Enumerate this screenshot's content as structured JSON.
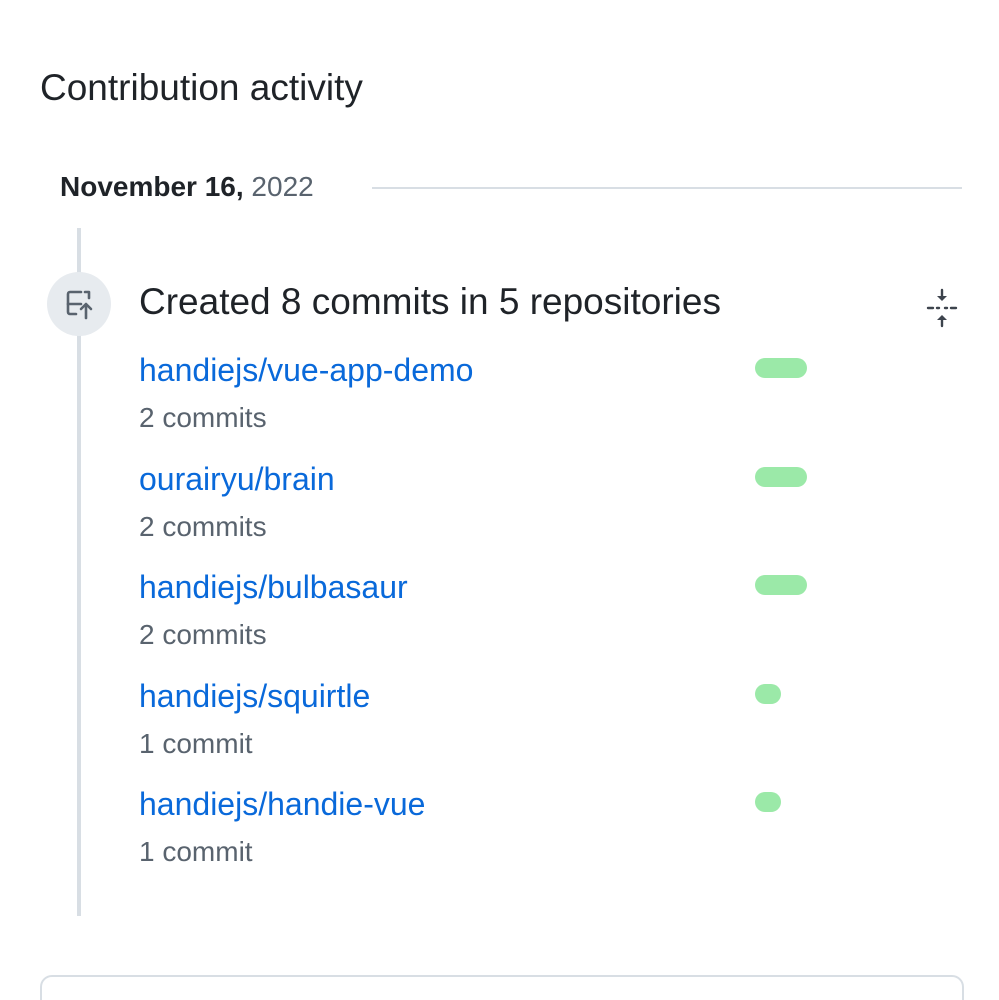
{
  "section": {
    "title": "Contribution activity"
  },
  "date": {
    "month_day": "November 16,",
    "year": "2022"
  },
  "event": {
    "icon": "repo-push-icon",
    "title": "Created 8 commits in 5 repositories",
    "collapse_icon": "fold-icon"
  },
  "repos": [
    {
      "name": "handiejs/vue-app-demo",
      "count_label": "2 commits",
      "commits": 2,
      "bar_fraction": 1.0
    },
    {
      "name": "ourairyu/brain",
      "count_label": "2 commits",
      "commits": 2,
      "bar_fraction": 1.0
    },
    {
      "name": "handiejs/bulbasaur",
      "count_label": "2 commits",
      "commits": 2,
      "bar_fraction": 1.0
    },
    {
      "name": "handiejs/squirtle",
      "count_label": "1 commit",
      "commits": 1,
      "bar_fraction": 0.5
    },
    {
      "name": "handiejs/handie-vue",
      "count_label": "1 commit",
      "commits": 1,
      "bar_fraction": 0.5
    }
  ],
  "colors": {
    "link": "#0969da",
    "bar": "#9be9a8",
    "muted_text": "#59636e"
  }
}
